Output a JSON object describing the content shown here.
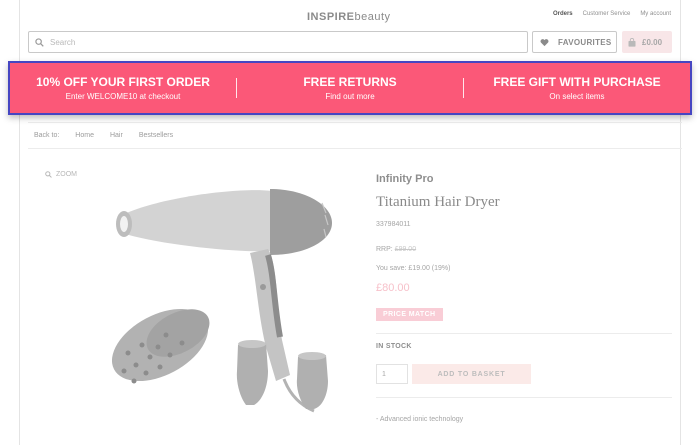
{
  "header": {
    "logo_bold": "INSPIRE",
    "logo_light": "beauty",
    "links": [
      "Orders",
      "Customer Service",
      "My account"
    ]
  },
  "search": {
    "placeholder": "Search"
  },
  "favourites": {
    "label": "FAVOURITES",
    "icon": "heart-icon"
  },
  "basket": {
    "label": "£0.00",
    "icon": "shopping-bag-icon"
  },
  "promo": {
    "background": "#fb5878",
    "items": [
      {
        "title": "10% OFF YOUR FIRST ORDER",
        "subtitle": "Enter WELCOME10 at checkout"
      },
      {
        "title": "FREE RETURNS",
        "subtitle": "Find out more"
      },
      {
        "title": "FREE GIFT WITH PURCHASE",
        "subtitle": "On select items"
      }
    ]
  },
  "breadcrumb": {
    "prefix": "Back to:",
    "items": [
      "Home",
      "Hair",
      "Bestsellers"
    ]
  },
  "gallery": {
    "zoom_label": "ZOOM",
    "zoom_icon": "search-icon"
  },
  "product": {
    "brand": "Infinity Pro",
    "name": "Titanium Hair Dryer",
    "sku": "337984011",
    "rrp_label": "RRP:",
    "rrp_value": "£99.00",
    "saving": "You save: £19.00 (19%)",
    "price": "£80.00",
    "badge": "PRICE MATCH",
    "stock": "IN STOCK",
    "quantity": "1",
    "add_label": "ADD TO BASKET",
    "features": [
      "- Advanced ionic technology"
    ]
  }
}
